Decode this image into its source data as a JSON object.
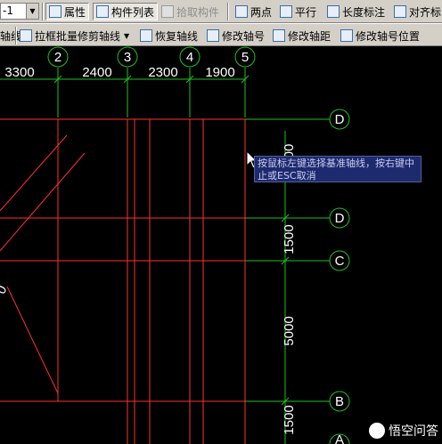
{
  "toolbar_top": {
    "combo_value": "-1",
    "properties": "属性",
    "component_list": "构件列表",
    "pick_component": "拾取构件",
    "two_points": "两点",
    "parallel": "平行",
    "length_dimension": "长度标注",
    "align": "对齐标"
  },
  "toolbar_second": {
    "axis_partial": "轴线",
    "box_trim_axis": "拉框批量修剪轴线",
    "restore_axis": "恢复轴线",
    "modify_axis_number": "修改轴号",
    "modify_axis_spacing": "修改轴距",
    "modify_axis_number_position": "修改轴号位置"
  },
  "axes": {
    "top_numbers": [
      "2",
      "3",
      "4",
      "5"
    ],
    "top_dimensions": [
      "3300",
      "2400",
      "2300",
      "1900"
    ],
    "right_letters": [
      "D",
      "D",
      "C",
      "B",
      "A"
    ],
    "right_dimensions": [
      "00",
      "1500",
      "5000",
      "1500"
    ],
    "left_fragment": "0"
  },
  "tooltip": {
    "text": "按鼠标左键选择基准轴线，按右键中止或ESC取消"
  },
  "watermark": {
    "text": "悟空问答"
  },
  "colors": {
    "background": "#000000",
    "axis_line": "#ff3030",
    "dimension_line": "#20c020",
    "label_text": "#ffffff"
  }
}
